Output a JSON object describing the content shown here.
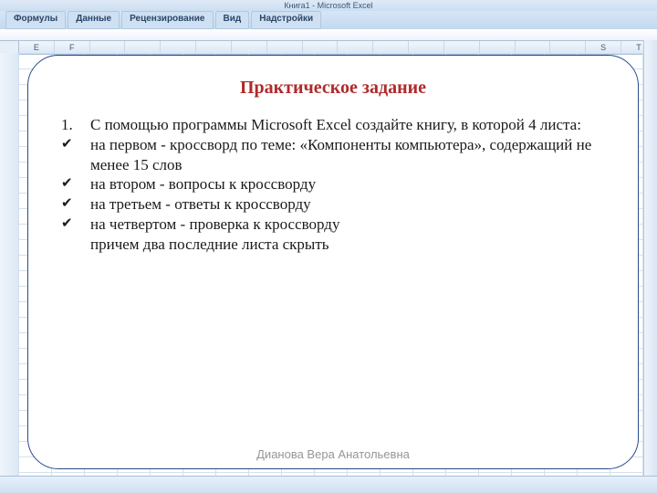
{
  "title_bar": "Книга1 - Microsoft Excel",
  "ribbon": {
    "tabs": [
      "Формулы",
      "Данные",
      "Рецензирование",
      "Вид",
      "Надстройки"
    ]
  },
  "columns": [
    "E",
    "F",
    "",
    "",
    "",
    "",
    "",
    "",
    "",
    "",
    "",
    "",
    "",
    "",
    "",
    "",
    "S",
    "T"
  ],
  "card": {
    "title": "Практическое задание",
    "item_number": "1.",
    "check_glyph": "✔",
    "lines": {
      "intro": "С помощью программы Microsoft Excel создайте книгу, в которой 4 листа:",
      "l1": " на первом - кроссворд по теме: «Компоненты компьютера», содержащий не менее 15 слов",
      "l2": "на втором - вопросы к кроссворду",
      "l3": "на третьем - ответы к кроссворду",
      "l4": "на четвертом - проверка к кроссворду",
      "l5": "причем два последние листа скрыть"
    }
  },
  "footer_author": "Дианова Вера Анатольевна"
}
